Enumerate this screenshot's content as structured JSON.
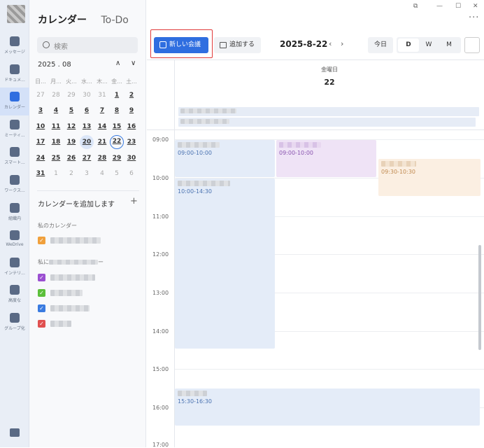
{
  "app_tabs": {
    "calendar": "カレンダー",
    "todo": "To-Do"
  },
  "nav": [
    {
      "name": "messages",
      "label": "メッセージ"
    },
    {
      "name": "documents",
      "label": "ドキュメ..."
    },
    {
      "name": "calendar",
      "label": "カレンダー"
    },
    {
      "name": "meetings",
      "label": "ミーティ..."
    },
    {
      "name": "smart",
      "label": "スマート..."
    },
    {
      "name": "workspace",
      "label": "ワークス..."
    },
    {
      "name": "org",
      "label": "組織内"
    },
    {
      "name": "wedrive",
      "label": "WeDrive"
    },
    {
      "name": "integration",
      "label": "インテリ..."
    },
    {
      "name": "advanced",
      "label": "高度な"
    },
    {
      "name": "groups",
      "label": "グループ化"
    }
  ],
  "search": {
    "placeholder": "検索"
  },
  "mini_calendar": {
    "month_label": "2025 . 08",
    "weekdays": [
      "日...",
      "月...",
      "火...",
      "水...",
      "木...",
      "金...",
      "土..."
    ],
    "weeks": [
      [
        "27",
        "28",
        "29",
        "30",
        "31",
        "1",
        "2"
      ],
      [
        "3",
        "4",
        "5",
        "6",
        "7",
        "8",
        "9"
      ],
      [
        "10",
        "11",
        "12",
        "13",
        "14",
        "15",
        "16"
      ],
      [
        "17",
        "18",
        "19",
        "20",
        "21",
        "22",
        "23"
      ],
      [
        "24",
        "25",
        "26",
        "27",
        "28",
        "29",
        "30"
      ],
      [
        "31",
        "1",
        "2",
        "3",
        "4",
        "5",
        "6"
      ]
    ],
    "selected": "20",
    "today": "22"
  },
  "calendars": {
    "add_label": "カレンダーを追加します",
    "my_group": "私のカレンダー",
    "shared_group": "私に",
    "shared_group_suffix": "ー",
    "colors": {
      "orange": "#f0a03c",
      "purple": "#9b4fd1",
      "green": "#5bbf3a",
      "blue": "#3a7be0",
      "red": "#e05050"
    }
  },
  "toolbar": {
    "new_meeting": "新しい会議",
    "add": "追加する",
    "date": "2025-8-22",
    "today": "今日",
    "views": [
      "D",
      "W",
      "M"
    ],
    "active_view": "D"
  },
  "day_header": {
    "weekday": "金曜日",
    "date": "22"
  },
  "hours": [
    "09:00",
    "10:00",
    "11:00",
    "12:00",
    "13:00",
    "14:00",
    "15:00",
    "16:00",
    "17:00"
  ],
  "events": [
    {
      "time": "09:00-10:00",
      "color": "#e4ecf8",
      "text_color": "#4a72b0"
    },
    {
      "time": "09:00-10:00",
      "color": "#efe3f6",
      "text_color": "#8a55b0"
    },
    {
      "time": "09:30-10:30",
      "color": "#fbefe2",
      "text_color": "#c08a50"
    },
    {
      "time": "10:00-14:30",
      "color": "#e4ecf8",
      "text_color": "#4a72b0"
    },
    {
      "time": "15:30-16:30",
      "color": "#e4ecf8",
      "text_color": "#4a72b0"
    }
  ]
}
